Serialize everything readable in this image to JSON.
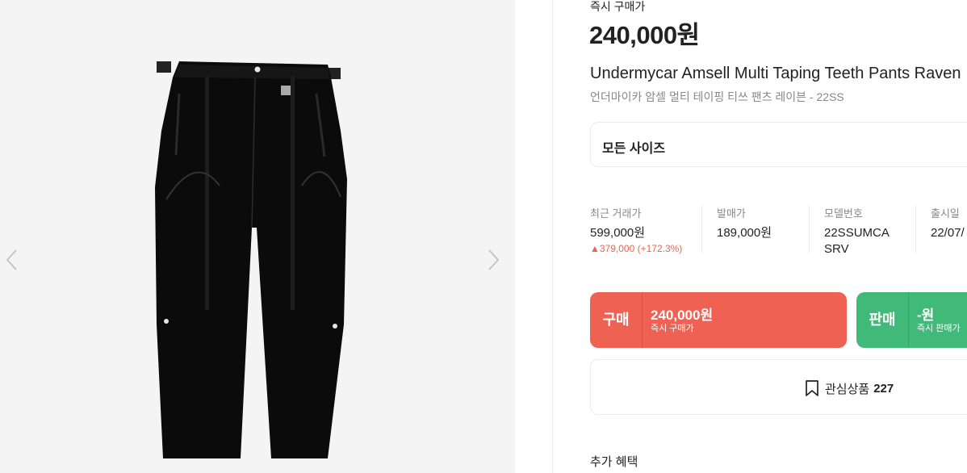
{
  "gallery": {
    "product_image_alt": "Undermycar Amsell Multi Taping Teeth Pants Raven"
  },
  "price": {
    "label": "즉시 구매가",
    "value": "240,000원"
  },
  "product": {
    "title_en": "Undermycar Amsell Multi Taping Teeth Pants Raven",
    "title_ko": "언더마이카 암셀 멀티 테이핑 티쓰 팬츠 레이븐 - 22SS"
  },
  "size": {
    "label": "모든 사이즈"
  },
  "info": {
    "recent": {
      "label": "최근 거래가",
      "value": "599,000원",
      "change": "▲379,000 (+172.3%)"
    },
    "release_price": {
      "label": "발매가",
      "value": "189,000원"
    },
    "model": {
      "label": "모델번호",
      "value": "22SSUMCA SRV"
    },
    "release_date": {
      "label": "출시일",
      "value": "22/07/"
    }
  },
  "buy": {
    "label": "구매",
    "amount": "240,000원",
    "sub": "즉시 구매가"
  },
  "sell": {
    "label": "판매",
    "amount": "-원",
    "sub": "즉시 판매가"
  },
  "wish": {
    "label": "관심상품",
    "count": "227"
  },
  "benefit": {
    "label": "추가 혜택"
  },
  "colors": {
    "buy": "#ef6253",
    "sell": "#41b979",
    "price_up": "#ef6253",
    "muted_text": "#888888"
  }
}
